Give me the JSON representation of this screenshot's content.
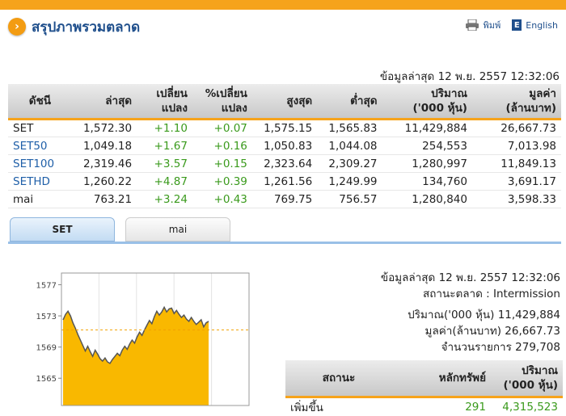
{
  "header": {
    "title": "สรุปภาพรวมตลาด",
    "print_label": "พิมพ์",
    "english_label": "English"
  },
  "summary": {
    "updated": "ข้อมูลล่าสุด 12 พ.ย. 2557 12:32:06",
    "columns": [
      [
        "ดัชนี"
      ],
      [
        "ล่าสุด"
      ],
      [
        "เปลี่ยน",
        "แปลง"
      ],
      [
        "%เปลี่ยน",
        "แปลง"
      ],
      [
        "สูงสุด"
      ],
      [
        "ต่ำสุด"
      ],
      [
        "ปริมาณ",
        "('000 หุ้น)"
      ],
      [
        "มูลค่า",
        "(ล้านบาท)"
      ]
    ],
    "rows": [
      {
        "name": "SET",
        "last": "1,572.30",
        "change": "+1.10",
        "pct": "+0.07",
        "high": "1,575.15",
        "low": "1,565.83",
        "volume": "11,429,884",
        "value": "26,667.73"
      },
      {
        "name": "SET50",
        "last": "1,049.18",
        "change": "+1.67",
        "pct": "+0.16",
        "high": "1,050.83",
        "low": "1,044.08",
        "volume": "254,553",
        "value": "7,013.98"
      },
      {
        "name": "SET100",
        "last": "2,319.46",
        "change": "+3.57",
        "pct": "+0.15",
        "high": "2,323.64",
        "low": "2,309.27",
        "volume": "1,280,997",
        "value": "11,849.13"
      },
      {
        "name": "SETHD",
        "last": "1,260.22",
        "change": "+4.87",
        "pct": "+0.39",
        "high": "1,261.56",
        "low": "1,249.99",
        "volume": "134,760",
        "value": "3,691.17"
      },
      {
        "name": "mai",
        "last": "763.21",
        "change": "+3.24",
        "pct": "+0.43",
        "high": "769.75",
        "low": "756.57",
        "volume": "1,280,840",
        "value": "3,598.33"
      }
    ]
  },
  "tabs": [
    {
      "label": "SET",
      "active": true
    },
    {
      "label": "mai",
      "active": false
    }
  ],
  "market_info": {
    "updated": "ข้อมูลล่าสุด 12 พ.ย. 2557 12:32:06",
    "status": "สถานะตลาด : Intermission",
    "volume": "ปริมาณ('000 หุ้น) 11,429,884",
    "value": "มูลค่า(ล้านบาท) 26,667.73",
    "deals": "จำนวนรายการ 279,708"
  },
  "status_table": {
    "columns": [
      [
        "สถานะ"
      ],
      [
        "หลักทรัพย์"
      ],
      [
        "ปริมาณ",
        "('000 หุ้น)"
      ]
    ],
    "rows": [
      {
        "status": "เพิ่มขึ้น",
        "securities": "291",
        "volume": "4,315,523"
      }
    ]
  },
  "colors": {
    "accent": "#f6a31b",
    "title": "#1f4f8c",
    "positive": "#3a9a1c",
    "link": "#1f5fa8",
    "chart_fill": "#f9b800",
    "chart_line": "#555555"
  },
  "chart_data": {
    "type": "area",
    "y_ticks": [
      1577,
      1573,
      1569,
      1565
    ],
    "ylim": [
      1561.5,
      1578.5
    ],
    "reference_line": 1571.2,
    "x": [
      0,
      1,
      2,
      3,
      4,
      5,
      6,
      7,
      8,
      9,
      10,
      11,
      12,
      13,
      14,
      15,
      16,
      17,
      18,
      19,
      20,
      21,
      22,
      23,
      24,
      25,
      26,
      27,
      28,
      29,
      30,
      31,
      32,
      33,
      34,
      35,
      36,
      37,
      38,
      39,
      40,
      41,
      42,
      43,
      44,
      45,
      46,
      47,
      48,
      49,
      50,
      51,
      52,
      53,
      54,
      55,
      56,
      57,
      58,
      59
    ],
    "values": [
      1572.5,
      1573.2,
      1573.6,
      1573.0,
      1572.1,
      1571.4,
      1570.6,
      1569.9,
      1569.2,
      1568.5,
      1569.1,
      1568.4,
      1567.8,
      1568.6,
      1568.1,
      1567.5,
      1567.2,
      1567.6,
      1567.1,
      1566.9,
      1567.4,
      1567.8,
      1568.2,
      1567.9,
      1568.6,
      1569.1,
      1568.7,
      1569.4,
      1569.9,
      1569.5,
      1570.3,
      1570.9,
      1570.5,
      1571.2,
      1571.8,
      1572.4,
      1572.0,
      1572.9,
      1573.6,
      1573.1,
      1573.5,
      1574.1,
      1573.5,
      1573.9,
      1574.0,
      1573.3,
      1573.7,
      1573.2,
      1572.8,
      1573.1,
      1572.6,
      1572.3,
      1572.8,
      1572.3,
      1571.9,
      1572.2,
      1572.5,
      1571.6,
      1572.1,
      1572.3
    ]
  }
}
